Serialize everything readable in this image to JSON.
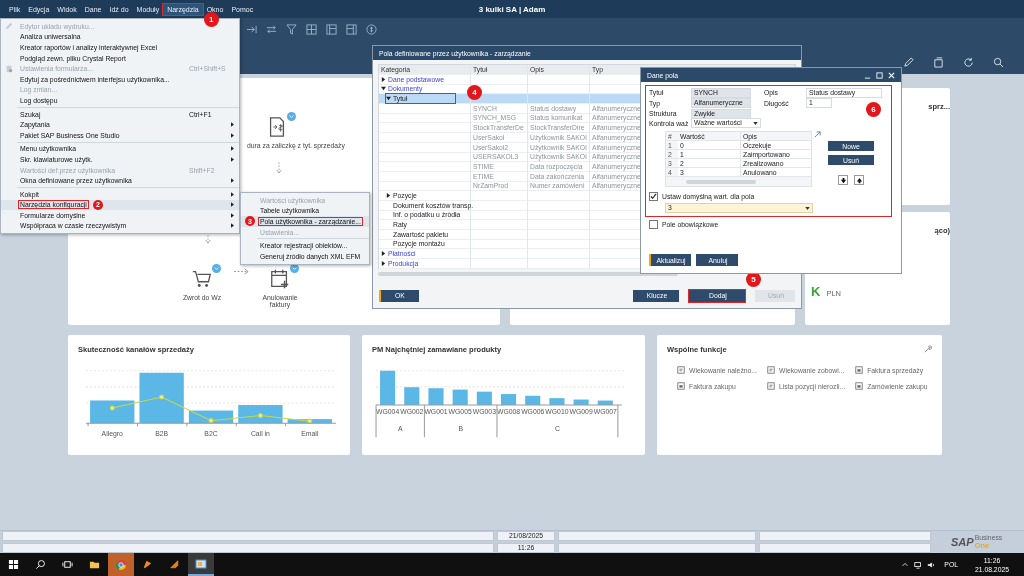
{
  "menubar": {
    "title": "3 kulki SA | Adam",
    "items": [
      {
        "label": "Plik",
        "selected": false
      },
      {
        "label": "Edycja",
        "selected": false
      },
      {
        "label": "Widok",
        "selected": false
      },
      {
        "label": "Dane",
        "selected": false
      },
      {
        "label": "Idź do",
        "selected": false
      },
      {
        "label": "Moduły",
        "selected": false
      },
      {
        "label": "Narzędzia",
        "selected": true,
        "marked": true,
        "callout": "1"
      },
      {
        "label": "Okno",
        "selected": false
      },
      {
        "label": "Pomoc",
        "selected": false
      }
    ]
  },
  "tools_menu": {
    "groups": [
      [
        {
          "label": "Edytor układu wydruku...",
          "disabled": true,
          "submenu": false,
          "selected": false
        },
        {
          "label": "Analiza uniwersalna",
          "disabled": false,
          "submenu": false,
          "selected": false
        },
        {
          "label": "Kreator raportów i analizy interaktywnej Excel",
          "disabled": false,
          "submenu": false,
          "selected": false
        },
        {
          "label": "Podgląd zewn. pliku Crystal Report",
          "disabled": false,
          "submenu": false,
          "selected": false
        },
        {
          "label": "Ustawienia formularza...",
          "shortcut": "Ctrl+Shift+S",
          "disabled": true,
          "submenu": false,
          "selected": false
        },
        {
          "label": "Edytuj za pośrednictwem interfejsu użytkownika...",
          "disabled": false,
          "submenu": false,
          "selected": false
        },
        {
          "label": "Log zmian...",
          "disabled": true,
          "submenu": false,
          "selected": false
        },
        {
          "label": "Log dostępu",
          "disabled": false,
          "submenu": false,
          "selected": false
        }
      ],
      [
        {
          "label": "Szukaj",
          "shortcut": "Ctrl+F1",
          "disabled": false,
          "submenu": false,
          "selected": false
        },
        {
          "label": "Zapytania",
          "disabled": false,
          "submenu": true,
          "selected": false
        },
        {
          "label": "Pakiet SAP Business One Studio",
          "disabled": false,
          "submenu": true,
          "selected": false
        }
      ],
      [
        {
          "label": "Menu użytkownika",
          "disabled": false,
          "submenu": true,
          "selected": false
        },
        {
          "label": "Skr. klawiaturowe użytk.",
          "disabled": false,
          "submenu": true,
          "selected": false
        },
        {
          "label": "Wartości def.przez użytkownika",
          "shortcut": "Shift+F2",
          "disabled": true,
          "submenu": false,
          "selected": false
        },
        {
          "label": "Okna definiowane przez użytkownika",
          "disabled": false,
          "submenu": true,
          "selected": false
        }
      ],
      [
        {
          "label": "Kokpit",
          "disabled": false,
          "submenu": true,
          "selected": false
        },
        {
          "label": "Narzędzia konfiguracji",
          "disabled": false,
          "submenu": true,
          "selected": true,
          "marked": true,
          "callout": "2"
        },
        {
          "label": "Formularze domyślne",
          "disabled": false,
          "submenu": true,
          "selected": false
        },
        {
          "label": "Współpraca w czasie rzeczywistym",
          "disabled": false,
          "submenu": true,
          "selected": false
        }
      ]
    ]
  },
  "submenu": {
    "groups": [
      [
        {
          "label": "Wartości użytkownika",
          "disabled": true,
          "submenu": false,
          "selected": false
        },
        {
          "label": "Tabele użytkownika",
          "disabled": false,
          "submenu": false,
          "selected": false
        },
        {
          "label": "Pola użytkownika - zarządzanie...",
          "disabled": false,
          "submenu": false,
          "selected": true,
          "marked": true,
          "callout": "3"
        },
        {
          "label": "Ustawienia...",
          "disabled": true,
          "submenu": false,
          "selected": false
        }
      ],
      [
        {
          "label": "Kreator rejestracji obiektów...",
          "disabled": false,
          "submenu": false,
          "selected": false
        },
        {
          "label": "Generuj źródło danych XML EFM",
          "disabled": false,
          "submenu": false,
          "selected": false
        }
      ]
    ]
  },
  "dashboard": {
    "flow": [
      {
        "label": "dura za zaliczkę z tyt. sprzedaży",
        "kind": "invoice"
      },
      {
        "label": "Zwrot do Wz",
        "kind": "cart"
      },
      {
        "label": "Anulowanie faktury",
        "kind": "invoice-add"
      }
    ],
    "right_cards": [
      {
        "title": "sprz..."
      },
      {
        "title": "ąco)",
        "value": "K",
        "unit": "PLN"
      }
    ],
    "channel_chart": {
      "title": "Skuteczność kanałów sprzedaży",
      "labels": [
        "Allegro",
        "B2B",
        "B2C",
        "Call in",
        "Email"
      ]
    },
    "products_chart": {
      "title": "PM Najchętniej zamawiane produkty",
      "groups": [
        {
          "label": "A",
          "items": [
            "WG004",
            "WG002"
          ]
        },
        {
          "label": "B",
          "items": [
            "WG001",
            "WG005",
            "WG003"
          ]
        },
        {
          "label": "C",
          "items": [
            "WG008",
            "WG006",
            "WG010",
            "WG009",
            "WG007"
          ]
        }
      ]
    },
    "shortcuts": {
      "title": "Wspólne funkcje",
      "items": [
        {
          "label": "Wiekowanie należno...",
          "kind": "report"
        },
        {
          "label": "Wiekowanie zobowi...",
          "kind": "report"
        },
        {
          "label": "Faktura sprzedaży",
          "kind": "form"
        },
        {
          "label": "Faktura zakupu",
          "kind": "form"
        },
        {
          "label": "Lista pozycji nierozli...",
          "kind": "report"
        },
        {
          "label": "Zamówienie zakupu",
          "kind": "form"
        }
      ]
    }
  },
  "user_fields_window": {
    "title": "Pola definiowane przez użytkownika - zarządzanie",
    "columns": [
      "Kategoria",
      "Tytuł",
      "Opis",
      "Typ"
    ],
    "tree": [
      {
        "label": "Dane podstawowe",
        "expanded": false,
        "selected": false
      },
      {
        "label": "Dokumenty",
        "expanded": true,
        "selected": false,
        "children": [
          {
            "label": "Tytuł",
            "expanded": true,
            "selected": true,
            "marked": true,
            "callout": "4",
            "fields": [
              {
                "title": "SYNCH",
                "description": "Status dostawy",
                "type": "Alfanumeryczne",
                "selected": false
              },
              {
                "title": "SYNCH_MSG",
                "description": "Status komunikat",
                "type": "Alfanumeryczne",
                "selected": false
              },
              {
                "title": "StockTransferDe",
                "description": "StockTransferDire",
                "type": "Alfanumeryczne",
                "selected": false
              },
              {
                "title": "UserSakol",
                "description": "Użytkownik SAKOl",
                "type": "Alfanumeryczne",
                "selected": false
              },
              {
                "title": "UserSakol2",
                "description": "Użytkownik SAKOl",
                "type": "Alfanumeryczne",
                "selected": false
              },
              {
                "title": "USERSAKOL3",
                "description": "Użytkownik SAKOl",
                "type": "Alfanumeryczne",
                "selected": false
              },
              {
                "title": "STIME",
                "description": "Data rozpoczęcia",
                "type": "Alfanumeryczne",
                "selected": false
              },
              {
                "title": "ETIME",
                "description": "Data zakończenia",
                "type": "Alfanumeryczne",
                "selected": false
              },
              {
                "title": "NrZamProd",
                "description": "Numer zamówieni",
                "type": "Alfanumeryczne",
                "selected": false
              }
            ]
          },
          {
            "label": "Pozycje",
            "expanded": false,
            "selected": false
          },
          {
            "label": "Dokument kosztów transp.",
            "selected": false
          },
          {
            "label": "Inf. o podatku u źródła",
            "selected": false
          },
          {
            "label": "Raty",
            "selected": false
          },
          {
            "label": "Zawartość pakietu",
            "selected": false
          },
          {
            "label": "Pozycje montażu",
            "selected": false
          }
        ]
      },
      {
        "label": "Płatności",
        "expanded": false,
        "selected": false
      },
      {
        "label": "Produkcja",
        "expanded": false,
        "selected": false
      }
    ],
    "buttons": [
      {
        "label": "OK",
        "default": true,
        "disabled": false
      },
      {
        "label": "Klucze",
        "default": false,
        "disabled": false
      },
      {
        "label": "Dodaj",
        "default": false,
        "disabled": false,
        "marked": true,
        "callout": "5"
      },
      {
        "label": "Usuń",
        "default": false,
        "disabled": true
      }
    ]
  },
  "field_dialog": {
    "title": "Dane pola",
    "marked": true,
    "callout": "6",
    "fields": [
      {
        "label": "Tytuł",
        "value": "SYNCH",
        "readonly": true
      },
      {
        "label": "Opis",
        "value": "Status dostawy",
        "readonly": false
      },
      {
        "label": "Typ",
        "value": "Alfanumeryczne",
        "readonly": true
      },
      {
        "label": "Długość",
        "value": "1",
        "readonly": false
      },
      {
        "label": "Struktura",
        "value": "Zwykłe",
        "readonly": true
      }
    ],
    "validation": {
      "label": "Kontrola waż",
      "value": "Ważne wartości"
    },
    "values_table": {
      "columns": [
        "#",
        "Wartość",
        "Opis"
      ],
      "rows": [
        {
          "num": "1",
          "value": "0",
          "description": "Oczekuje"
        },
        {
          "num": "2",
          "value": "1",
          "description": "Zaimportowano"
        },
        {
          "num": "3",
          "value": "2",
          "description": "Zrealizowano"
        },
        {
          "num": "4",
          "value": "3",
          "description": "Anulowano"
        }
      ]
    },
    "side_buttons": [
      "Nowe",
      "Usuń"
    ],
    "default_value": {
      "label": "Ustaw domyślną wart. dla pola",
      "checked": true,
      "value": "3"
    },
    "mandatory": {
      "label": "Pole obowiązkowe",
      "checked": false
    },
    "buttons": [
      {
        "label": "Aktualizuj",
        "default": true
      },
      {
        "label": "Anuluj",
        "default": false
      }
    ]
  },
  "status_bar": {
    "date": "21/08/2025",
    "time": "11:26",
    "logo": "SAP",
    "logo_sub": "Business",
    "logo_product": "One"
  },
  "taskbar": {
    "language": "POL",
    "time": "11:26",
    "date": "21.08.2025"
  }
}
